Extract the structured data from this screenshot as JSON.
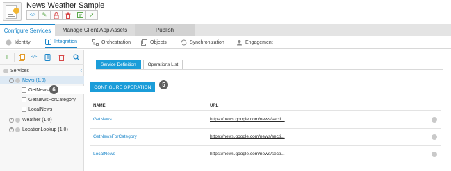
{
  "app": {
    "title": "News Weather Sample",
    "toolbar": [
      {
        "name": "code-icon",
        "glyph": "</>"
      },
      {
        "name": "edit-icon",
        "glyph": "✎"
      },
      {
        "name": "lock-icon",
        "glyph": "🔒"
      },
      {
        "name": "delete-icon",
        "glyph": "🗑"
      },
      {
        "name": "publish-icon",
        "glyph": "▤"
      },
      {
        "name": "share-icon",
        "glyph": "➚"
      }
    ]
  },
  "main_tabs": [
    {
      "label": "Configure Services",
      "active": true
    },
    {
      "label": "Manage Client App Assets",
      "active": false
    },
    {
      "label": "Publish",
      "active": false
    }
  ],
  "sub_tabs": [
    {
      "label": "Identity",
      "icon": "identity-icon"
    },
    {
      "label": "Integration",
      "icon": "integration-icon",
      "active": true
    },
    {
      "label": "Orchestration",
      "icon": "orchestration-icon"
    },
    {
      "label": "Objects",
      "icon": "objects-icon"
    },
    {
      "label": "Synchronization",
      "icon": "sync-icon"
    },
    {
      "label": "Engagement",
      "icon": "engagement-icon"
    }
  ],
  "left_panel": {
    "services_label": "Services",
    "tree": [
      {
        "label": "News (1.0)",
        "expanded": true,
        "selected": true
      },
      {
        "label": "GetNews",
        "child": true
      },
      {
        "label": "GetNewsForCategory",
        "child": true
      },
      {
        "label": "LocalNews",
        "child": true
      },
      {
        "label": "Weather (1.0)",
        "expanded": false
      },
      {
        "label": "LocationLookup (1.0)",
        "expanded": false
      }
    ],
    "badge": "6"
  },
  "right_panel": {
    "tabs": [
      {
        "label": "Service Definition",
        "active": true
      },
      {
        "label": "Operations List",
        "active": false
      }
    ],
    "configure_button": "CONFIGURE OPERATION",
    "badge": "5",
    "columns": [
      "NAME",
      "URL"
    ],
    "rows": [
      {
        "name": "GetNews",
        "url": "https://news.google.com/news/secti..."
      },
      {
        "name": "GetNewsForCategory",
        "url": "https://news.google.com/news/secti..."
      },
      {
        "name": "LocalNews",
        "url": "https://news.google.com/news/secti..."
      }
    ]
  },
  "colors": {
    "accent": "#1b86c9",
    "button": "#1b9dd9",
    "badge": "#5f5f5f"
  }
}
